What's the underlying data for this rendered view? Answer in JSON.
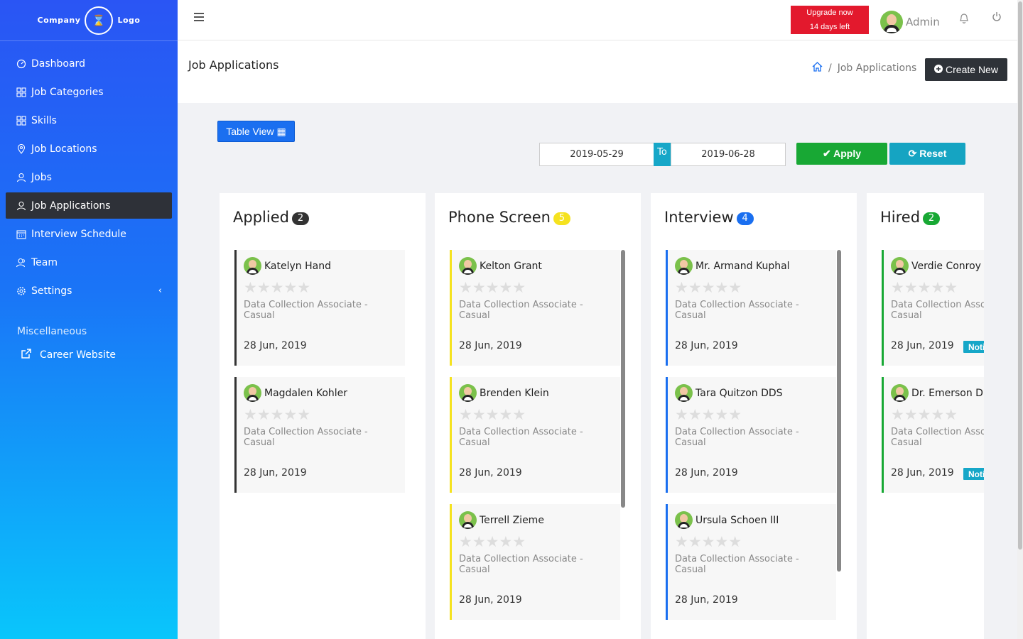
{
  "brand": {
    "left": "Company",
    "right": "Logo"
  },
  "sidebar": {
    "items": [
      {
        "label": "Dashboard",
        "icon": "dashboard-icon"
      },
      {
        "label": "Job Categories",
        "icon": "grid-icon"
      },
      {
        "label": "Skills",
        "icon": "grid-icon"
      },
      {
        "label": "Job Locations",
        "icon": "location-pin-icon"
      },
      {
        "label": "Jobs",
        "icon": "user-icon"
      },
      {
        "label": "Job Applications",
        "icon": "user-icon",
        "active": true
      },
      {
        "label": "Interview Schedule",
        "icon": "calendar-icon"
      },
      {
        "label": "Team",
        "icon": "team-icon"
      },
      {
        "label": "Settings",
        "icon": "gear-icon"
      }
    ],
    "section_label": "Miscellaneous",
    "career_label": "Career Website"
  },
  "topbar": {
    "upgrade_line1": "Upgrade now",
    "upgrade_line2": "14 days left",
    "user_name": "Admin"
  },
  "page": {
    "title": "Job Applications",
    "breadcrumb_sep": "/",
    "breadcrumb_current": "Job Applications",
    "create_label": "Create New"
  },
  "filters": {
    "table_view_label": "Table View",
    "date_from": "2019-05-29",
    "to_label": "To",
    "date_to": "2019-06-28",
    "apply_label": "Apply",
    "reset_label": "Reset"
  },
  "colors": {
    "applied": "#333333",
    "phone": "#f5e21f",
    "interview": "#1a6ff0",
    "hired": "#18a834"
  },
  "columns": [
    {
      "title": "Applied",
      "count": "2",
      "cards": [
        {
          "name": "Katelyn Hand",
          "job": "Data Collection Associate - Casual",
          "date": "28 Jun, 2019"
        },
        {
          "name": "Magdalen Kohler",
          "job": "Data Collection Associate - Casual",
          "date": "28 Jun, 2019"
        }
      ]
    },
    {
      "title": "Phone Screen",
      "count": "5",
      "cards": [
        {
          "name": "Kelton Grant",
          "job": "Data Collection Associate - Casual",
          "date": "28 Jun, 2019"
        },
        {
          "name": "Brenden Klein",
          "job": "Data Collection Associate - Casual",
          "date": "28 Jun, 2019"
        },
        {
          "name": "Terrell Zieme",
          "job": "Data Collection Associate - Casual",
          "date": "28 Jun, 2019"
        }
      ]
    },
    {
      "title": "Interview",
      "count": "4",
      "cards": [
        {
          "name": "Mr. Armand Kuphal",
          "job": "Data Collection Associate - Casual",
          "date": "28 Jun, 2019"
        },
        {
          "name": "Tara Quitzon DDS",
          "job": "Data Collection Associate - Casual",
          "date": "28 Jun, 2019"
        },
        {
          "name": "Ursula Schoen III",
          "job": "Data Collection Associate - Casual",
          "date": "28 Jun, 2019"
        }
      ]
    },
    {
      "title": "Hired",
      "count": "2",
      "notify_label": "Notify",
      "cards": [
        {
          "name": "Verdie Conroy",
          "job": "Data Collection Associate - Casual",
          "date": "28 Jun, 2019"
        },
        {
          "name": "Dr. Emerson Du",
          "job": "Data Collection Associate - Casual",
          "date": "28 Jun, 2019"
        }
      ]
    }
  ]
}
